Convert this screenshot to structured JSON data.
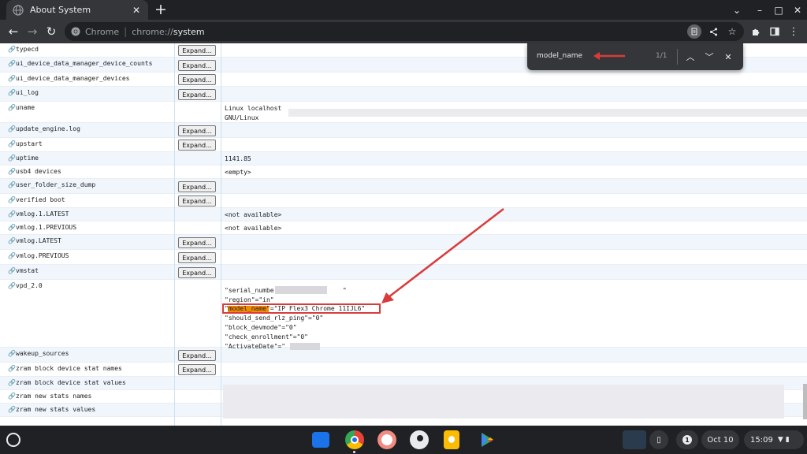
{
  "tab": {
    "title": "About System",
    "close_icon": "close-icon"
  },
  "window": {
    "new_tab": "+",
    "dropdown": "⌄",
    "minimize": "–",
    "maximize": "□",
    "close": "✕"
  },
  "toolbar": {
    "back": "←",
    "forward": "→",
    "reload": "↻",
    "scheme_label": "Chrome",
    "url_prefix": "chrome://",
    "url_host": "system",
    "icons": [
      "page-info-icon",
      "share-icon",
      "bookmark-star-icon",
      "extensions-icon",
      "side-panel-icon",
      "menu-icon"
    ]
  },
  "find": {
    "query": "model_name",
    "count": "1/1"
  },
  "rows": [
    {
      "name": "typecd",
      "expand": "Expand..."
    },
    {
      "name": "ui_device_data_manager_device_counts",
      "expand": "Expand..."
    },
    {
      "name": "ui_device_data_manager_devices",
      "expand": "Expand..."
    },
    {
      "name": "ui_log",
      "expand": "Expand..."
    },
    {
      "name": "uname",
      "value": "Linux localhost\nGNU/Linux"
    },
    {
      "name": "update_engine.log",
      "expand": "Expand..."
    },
    {
      "name": "upstart",
      "expand": "Expand..."
    },
    {
      "name": "uptime",
      "value": "1141.85"
    },
    {
      "name": "usb4 devices",
      "value": "<empty>"
    },
    {
      "name": "user_folder_size_dump",
      "expand": "Expand..."
    },
    {
      "name": "verified boot",
      "expand": "Expand..."
    },
    {
      "name": "vmlog.1.LATEST",
      "value": "<not available>"
    },
    {
      "name": "vmlog.1.PREVIOUS",
      "value": "<not available>"
    },
    {
      "name": "vmlog.LATEST",
      "expand": "Expand..."
    },
    {
      "name": "vmlog.PREVIOUS",
      "expand": "Expand..."
    },
    {
      "name": "vmstat",
      "expand": "Expand..."
    },
    {
      "name": "vpd_2.0"
    },
    {
      "name": "wakeup_sources",
      "expand": "Expand..."
    },
    {
      "name": "zram block device stat names",
      "expand": "Expand..."
    },
    {
      "name": "zram block device stat values"
    },
    {
      "name": "zram new stats names"
    },
    {
      "name": "zram new stats values"
    }
  ],
  "vpd": {
    "serial": "\"serial_number\"=\"",
    "serial_end": "\"",
    "region": "\"region\"=\"in\"",
    "model_key": "\"model_name",
    "model_rest": "\"=\"IP Flex3 Chrome 11IJL6\"",
    "rlz": "\"should_send_rlz_ping\"=\"0\"",
    "devmode": "\"block_devmode\"=\"0\"",
    "enrollment": "\"check_enrollment\"=\"0\"",
    "activate": "\"ActivateDate\"=\"",
    "activate_end": "\""
  },
  "shelf": {
    "apps": [
      "files-app-icon",
      "chrome-app-icon",
      "cursive-app-icon",
      "duck-app-icon",
      "keep-app-icon",
      "play-store-icon"
    ],
    "date": "Oct 10",
    "time": "15:09",
    "notifications": "1"
  },
  "colors": {
    "accent": "#8ab4f8",
    "highlight_box": "#d93b3b",
    "find_match": "#f28b00"
  }
}
